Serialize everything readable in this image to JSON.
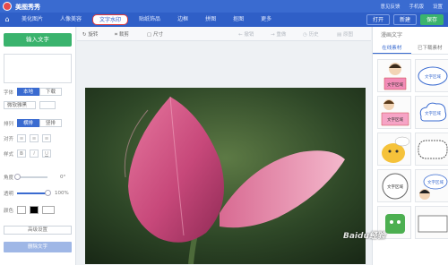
{
  "app": {
    "title": "美图秀秀",
    "top_links": [
      "意见反馈",
      "手机版",
      "设置"
    ]
  },
  "tabs": {
    "items": [
      "美化图片",
      "人像美容",
      "文字水印",
      "贴纸饰品",
      "边框",
      "拼图",
      "抠图",
      "更多"
    ],
    "active": "文字水印"
  },
  "top_buttons": {
    "open": "打开",
    "new": "新建",
    "save": "保存"
  },
  "left_panel": {
    "add_text": "输入文字",
    "typeface_label": "字体",
    "typeface_options": [
      "本地",
      "下载"
    ],
    "font_name": "微软雅黑",
    "font_size": "",
    "layout_label": "排列",
    "layout_options": [
      "横排",
      "竖排"
    ],
    "align_label": "对齐",
    "style_label": "样式",
    "style_options": [
      "B",
      "I",
      "U"
    ],
    "angle_label": "角度",
    "angle_value": "0°",
    "angle_level": 0.0,
    "opacity_label": "透明",
    "opacity_value": "100%",
    "opacity_level": 1.0,
    "color_label": "颜色",
    "advanced_label": "高级设置",
    "delete_label": "删除文字"
  },
  "toolbar": {
    "rotate": "旋转",
    "crop": "裁剪",
    "size": "尺寸",
    "undo": "撤销",
    "redo": "重做",
    "reset": "历史",
    "compare": "原图"
  },
  "right_panel": {
    "title": "漫画文字",
    "tabs": [
      "在线素材",
      "已下载素材"
    ],
    "sticker_text": "文字区域"
  },
  "watermark": "Baidu经验",
  "colors": {
    "brand_blue": "#3a6bd0",
    "tab_bar": "#2f5fc7",
    "green": "#3ab36d",
    "active_tab_outline": "#e23b3b"
  }
}
